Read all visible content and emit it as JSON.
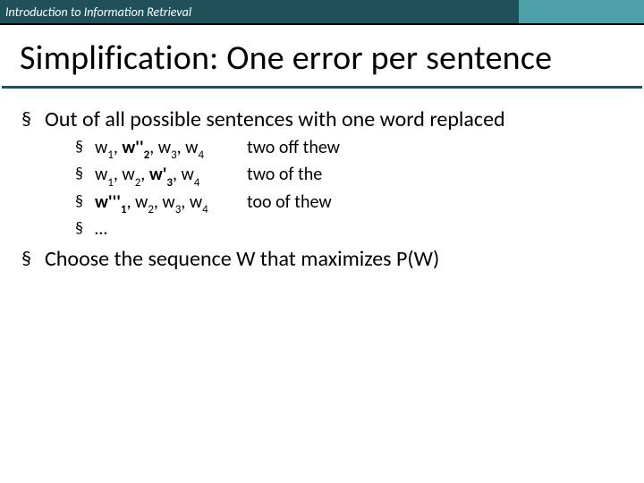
{
  "header": {
    "course": "Introduction to Information Retrieval"
  },
  "title": "Simplification: One error per sentence",
  "bullets": {
    "b1": "Out of all possible sentences with one word replaced",
    "sub": {
      "s1": {
        "example": " two off thew"
      },
      "s2": {
        "example": "two of the"
      },
      "s3": {
        "example": "too of thew"
      },
      "s4": {
        "text": "…"
      }
    },
    "b2": "Choose the sequence W that maximizes P(W)"
  }
}
